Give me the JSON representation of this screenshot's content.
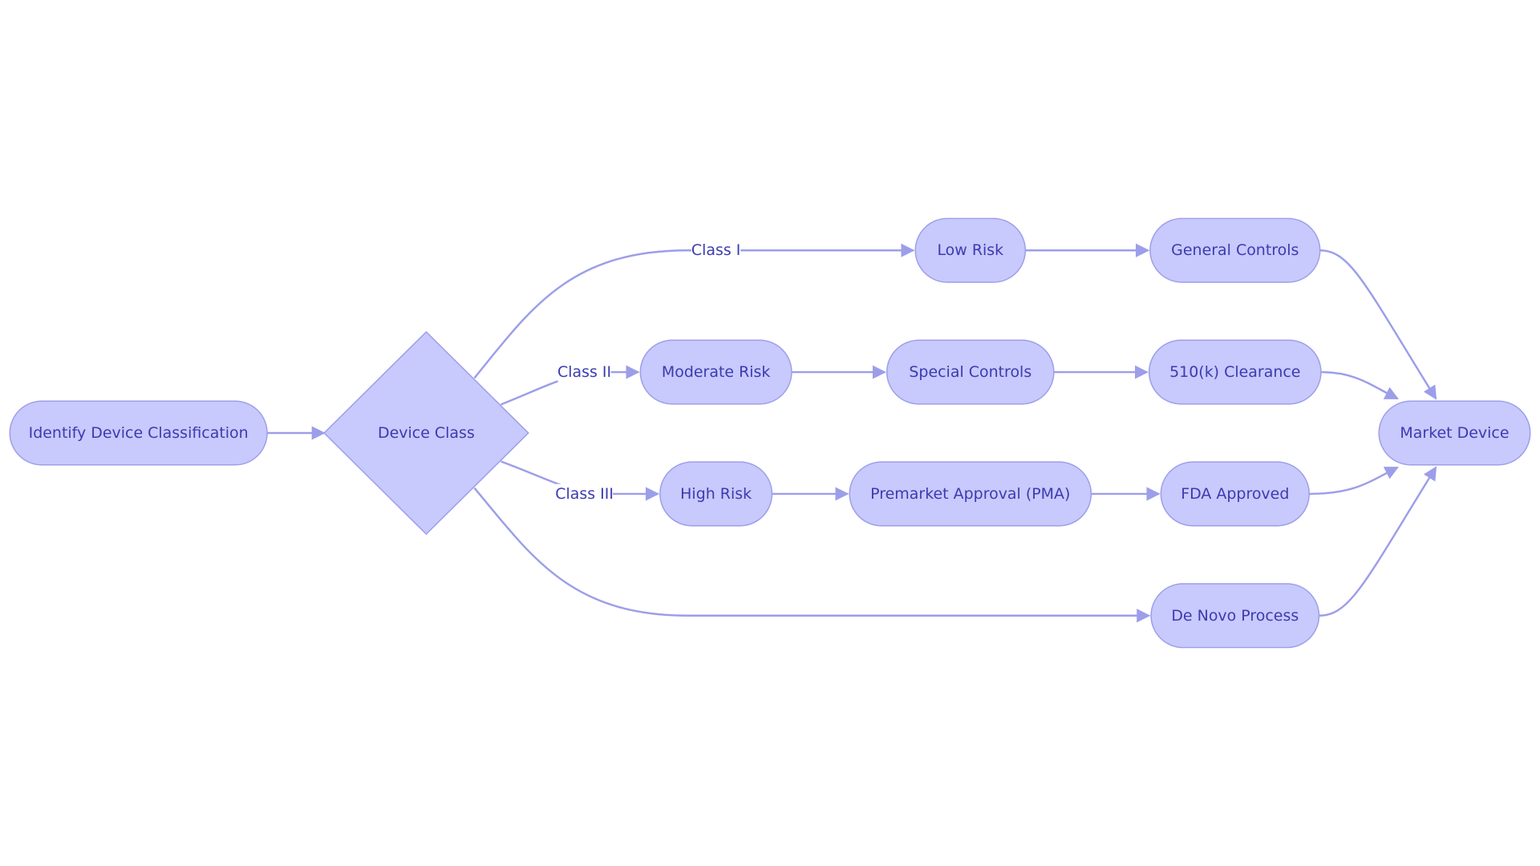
{
  "nodes": {
    "identify": "Identify Device Classification",
    "device_class": "Device Class",
    "low_risk": "Low Risk",
    "general_controls": "General Controls",
    "moderate_risk": "Moderate Risk",
    "special_controls": "Special Controls",
    "clearance_510k": "510(k) Clearance",
    "high_risk": "High Risk",
    "pma": "Premarket Approval (PMA)",
    "fda_approved": "FDA Approved",
    "de_novo": "De Novo Process",
    "market_device": "Market Device"
  },
  "edge_labels": {
    "class_1": "Class I",
    "class_2": "Class II",
    "class_3": "Class III"
  },
  "colors": {
    "node_fill": "#c8c9fc",
    "node_stroke": "#9c9ee9",
    "edge": "#9c9ee9",
    "text": "#3b3bb0"
  }
}
